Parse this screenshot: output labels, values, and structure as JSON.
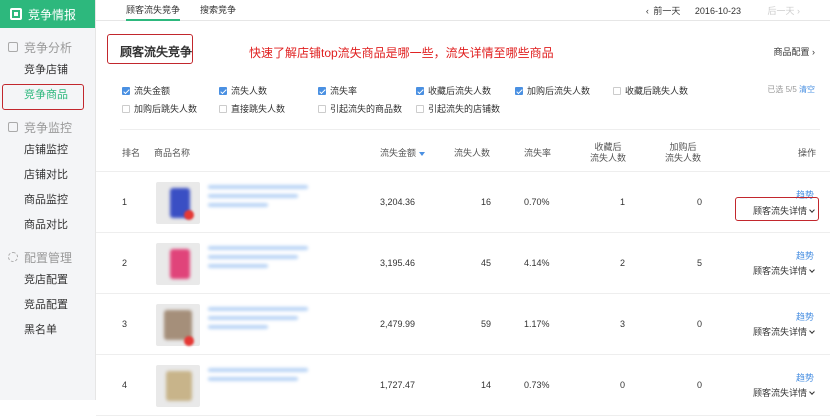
{
  "sidebar": {
    "brand": "竞争情报",
    "sections": [
      {
        "title": "竞争分析",
        "items": [
          "竞争店铺",
          "竞争商品"
        ]
      },
      {
        "title": "竞争监控",
        "items": [
          "店铺监控",
          "店铺对比",
          "商品监控",
          "商品对比"
        ]
      },
      {
        "title": "配置管理",
        "items": [
          "竞店配置",
          "竞品配置",
          "黑名单"
        ]
      }
    ],
    "active_item": "竞争商品"
  },
  "tabs": [
    "顾客流失竞争",
    "搜索竞争"
  ],
  "date_nav": {
    "prev": "前一天",
    "date": "2016-10-23",
    "next": "后一天"
  },
  "page_title": "顾客流失竞争",
  "annotation": "快速了解店铺top流失商品是哪一些，流失详情至哪些商品",
  "config_link": "商品配置",
  "filters": {
    "items": [
      {
        "label": "流失金额",
        "checked": true
      },
      {
        "label": "流失人数",
        "checked": true
      },
      {
        "label": "流失率",
        "checked": true
      },
      {
        "label": "收藏后流失人数",
        "checked": true
      },
      {
        "label": "加购后流失人数",
        "checked": true
      },
      {
        "label": "收藏后跳失人数",
        "checked": false
      },
      {
        "label": "加购后跳失人数",
        "checked": false
      },
      {
        "label": "直接跳失人数",
        "checked": false
      },
      {
        "label": "引起流失的商品数",
        "checked": false
      },
      {
        "label": "引起流失的店铺数",
        "checked": false
      }
    ],
    "selected": "已选 5/5",
    "clear": "清空"
  },
  "table": {
    "headers": {
      "rank": "排名",
      "name": "商品名称",
      "amount": "流失金额",
      "people": "流失人数",
      "rate": "流失率",
      "fav_top": "收藏后",
      "fav_bottom": "流失人数",
      "cart_top": "加购后",
      "cart_bottom": "流失人数",
      "action": "操作"
    },
    "action_trend": "趋势",
    "action_detail": "顾客流失详情",
    "rows": [
      {
        "rank": "1",
        "amount": "3,204.36",
        "people": "16",
        "rate": "0.70%",
        "fav": "1",
        "cart": "0",
        "color": "#3a4fc4"
      },
      {
        "rank": "2",
        "amount": "3,195.46",
        "people": "45",
        "rate": "4.14%",
        "fav": "2",
        "cart": "5",
        "color": "#e0447a"
      },
      {
        "rank": "3",
        "amount": "2,479.99",
        "people": "59",
        "rate": "1.17%",
        "fav": "3",
        "cart": "0",
        "color": "#a58f7a"
      },
      {
        "rank": "4",
        "amount": "1,727.47",
        "people": "14",
        "rate": "0.73%",
        "fav": "0",
        "cart": "0",
        "color": "#c8b48a"
      }
    ]
  }
}
